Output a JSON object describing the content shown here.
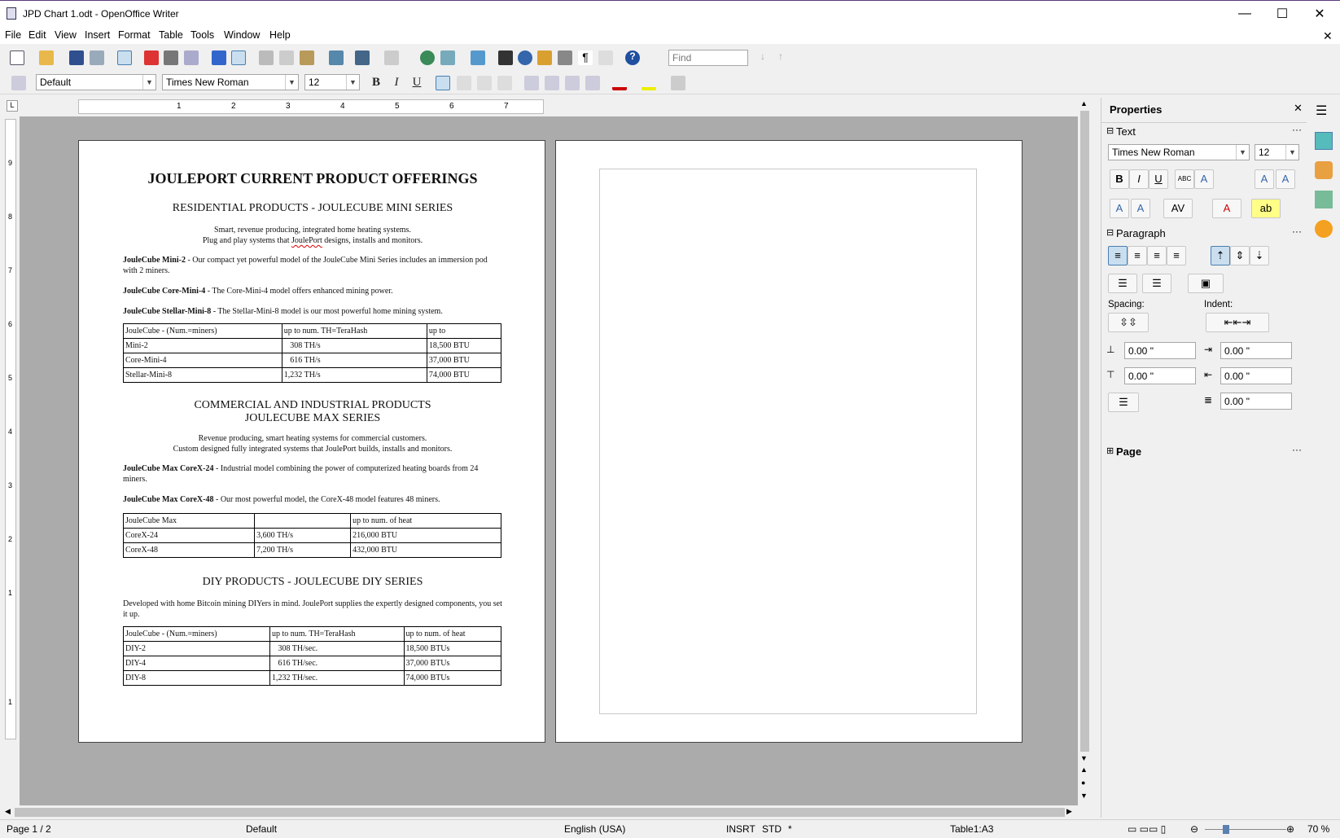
{
  "window": {
    "title": "JPD Chart 1.odt - OpenOffice Writer",
    "minimize": "—",
    "maximize": "☐",
    "close": "✕"
  },
  "menu": [
    "File",
    "Edit",
    "View",
    "Insert",
    "Format",
    "Table",
    "Tools",
    "Window",
    "Help"
  ],
  "toolbar": {
    "find_placeholder": "Find"
  },
  "format_bar": {
    "style": "Default",
    "font": "Times New Roman",
    "size": "12",
    "bold": "B",
    "italic": "I",
    "underline": "U"
  },
  "ruler": {
    "marks": [
      "1",
      "2",
      "3",
      "4",
      "5",
      "6",
      "7"
    ]
  },
  "vruler": {
    "marks": [
      "9",
      "8",
      "7",
      "6",
      "5",
      "4",
      "3",
      "2",
      "1",
      "1"
    ]
  },
  "doc": {
    "title": "JOULEPORT CURRENT PRODUCT OFFERINGS",
    "res_heading": "RESIDENTIAL PRODUCTS - JOULECUBE MINI SERIES",
    "res_intro1": "Smart, revenue producing, integrated home heating systems.",
    "res_intro2a": "Plug and play systems that ",
    "res_intro2b": "JoulePort",
    "res_intro2c": " designs, installs and monitors.",
    "mini2_name": "JouleCube Mini-2",
    "mini2_text": " - Our compact yet powerful model of the JouleCube Mini Series includes an immersion pod with 2 miners.",
    "core4_name": "JouleCube Core-Mini-4",
    "core4_text": " - The Core-Mini-4 model offers enhanced mining power.",
    "stellar_name": "JouleCube Stellar-Mini-8",
    "stellar_text": " - The Stellar-Mini-8 model is our most powerful home mining system.",
    "table1": [
      [
        "JouleCube - (Num.=miners)",
        "up to num. TH=TeraHash",
        "up to"
      ],
      [
        "Mini-2",
        "   308 TH/s",
        "18,500 BTU"
      ],
      [
        "Core-Mini-4",
        "   616 TH/s",
        "37,000 BTU"
      ],
      [
        "Stellar-Mini-8",
        "1,232 TH/s",
        "74,000 BTU"
      ]
    ],
    "com_heading1": "COMMERCIAL AND INDUSTRIAL PRODUCTS",
    "com_heading2": "JOULECUBE MAX SERIES",
    "com_intro1": "Revenue producing, smart heating systems for commercial customers.",
    "com_intro2": "Custom designed fully integrated systems that JoulePort builds, installs and monitors.",
    "max24_name": "JouleCube Max CoreX-24",
    "max24_text": " - Industrial model combining the power of computerized heating boards from 24 miners.",
    "max48_name": "JouleCube Max CoreX-48",
    "max48_text": " - Our most powerful model, the CoreX-48 model features 48 miners.",
    "table2": [
      [
        "JouleCube Max",
        "",
        "up to num. of heat"
      ],
      [
        "CoreX-24",
        "3,600 TH/s",
        "216,000 BTU"
      ],
      [
        "CoreX-48",
        "7,200 TH/s",
        "432,000 BTU"
      ]
    ],
    "diy_heading": "DIY PRODUCTS - JOULECUBE DIY SERIES",
    "diy_intro": "Developed with home Bitcoin mining DIYers in mind. JoulePort supplies the expertly designed components, you set it up.",
    "table3": [
      [
        "JouleCube - (Num.=miners)",
        "up to num. TH=TeraHash",
        "up to num. of heat"
      ],
      [
        "DIY-2",
        "   308 TH/sec.",
        "18,500 BTUs"
      ],
      [
        "DIY-4",
        "   616 TH/sec.",
        "37,000 BTUs"
      ],
      [
        "DIY-8",
        "1,232 TH/sec.",
        "74,000 BTUs"
      ]
    ]
  },
  "sidebar": {
    "title": "Properties",
    "text_section": "Text",
    "font": "Times New Roman",
    "size": "12",
    "paragraph_section": "Paragraph",
    "spacing_label": "Spacing:",
    "indent_label": "Indent:",
    "above": "0.00 \"",
    "below": "0.00 \"",
    "before": "0.00 \"",
    "after": "0.00 \"",
    "first": "0.00 \"",
    "page_section": "Page"
  },
  "status": {
    "page": "Page 1 / 2",
    "style": "Default",
    "language": "English (USA)",
    "mode": "INSRT",
    "sel": "STD",
    "mod": "*",
    "cell": "Table1:A3",
    "zoom": "70 %"
  }
}
